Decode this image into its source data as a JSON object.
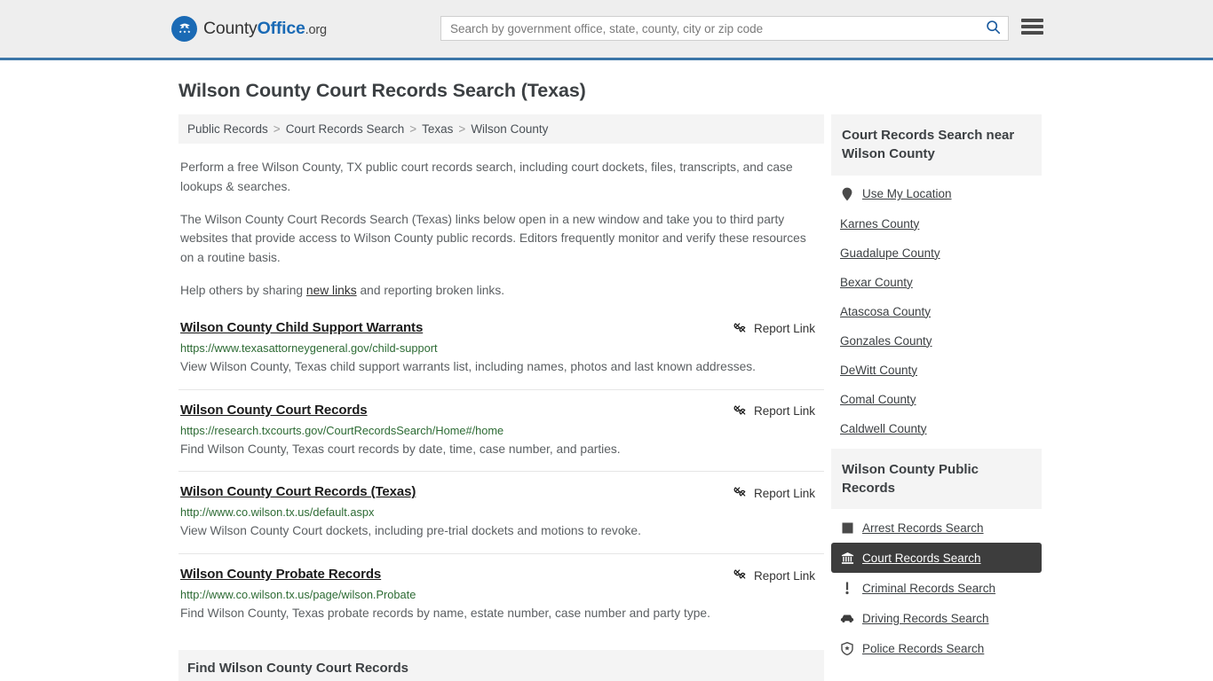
{
  "header": {
    "logo": {
      "icon": "eagle-seal-icon",
      "text_primary": "County",
      "text_accent": "Office",
      "text_suffix": ".org"
    },
    "search": {
      "placeholder": "Search by government office, state, county, city or zip code",
      "value": "",
      "search_icon": "search-icon"
    },
    "menu_icon": "hamburger-menu-icon",
    "accent_color": "#1a6ab5",
    "border_color": "#3b76a8",
    "background_color": "#eeeeee"
  },
  "page_title": "Wilson County Court Records Search (Texas)",
  "breadcrumb": [
    "Public Records",
    "Court Records Search",
    "Texas",
    "Wilson County"
  ],
  "breadcrumb_separator": ">",
  "intro": {
    "p1": "Perform a free Wilson County, TX public court records search, including court dockets, files, transcripts, and case lookups & searches.",
    "p2": "The Wilson County Court Records Search (Texas) links below open in a new window and take you to third party websites that provide access to Wilson County public records. Editors frequently monitor and verify these resources on a routine basis.",
    "p3_before": "Help others by sharing ",
    "p3_link": "new links",
    "p3_after": " and reporting broken links."
  },
  "report_link_label": "Report Link",
  "report_link_icon": "broken-link-icon",
  "results": [
    {
      "title": "Wilson County Child Support Warrants",
      "url": "https://www.texasattorneygeneral.gov/child-support",
      "description": "View Wilson County, Texas child support warrants list, including names, photos and last known addresses."
    },
    {
      "title": "Wilson County Court Records",
      "url": "https://research.txcourts.gov/CourtRecordsSearch/Home#/home",
      "description": "Find Wilson County, Texas court records by date, time, case number, and parties."
    },
    {
      "title": "Wilson County Court Records (Texas)",
      "url": "http://www.co.wilson.tx.us/default.aspx",
      "description": "View Wilson County Court dockets, including pre-trial dockets and motions to revoke."
    },
    {
      "title": "Wilson County Probate Records",
      "url": "http://www.co.wilson.tx.us/page/wilson.Probate",
      "description": "Find Wilson County, Texas probate records by name, estate number, case number and party type."
    }
  ],
  "bottom_section": {
    "heading": "Find Wilson County Court Records"
  },
  "sidebar": {
    "nearby": {
      "heading": "Court Records Search near Wilson County",
      "use_my_location": {
        "label": "Use My Location",
        "icon": "map-pin-icon"
      },
      "counties": [
        "Karnes County",
        "Guadalupe County",
        "Bexar County",
        "Atascosa County",
        "Gonzales County",
        "DeWitt County",
        "Comal County",
        "Caldwell County"
      ]
    },
    "public_records": {
      "heading": "Wilson County Public Records",
      "items": [
        {
          "label": "Arrest Records Search",
          "icon": "square-icon",
          "active": false
        },
        {
          "label": "Court Records Search",
          "icon": "courthouse-icon",
          "active": true
        },
        {
          "label": "Criminal Records Search",
          "icon": "exclamation-icon",
          "active": false
        },
        {
          "label": "Driving Records Search",
          "icon": "car-icon",
          "active": false
        },
        {
          "label": "Police Records Search",
          "icon": "shield-icon",
          "active": false
        }
      ],
      "active_background": "#3d3d3d"
    }
  }
}
